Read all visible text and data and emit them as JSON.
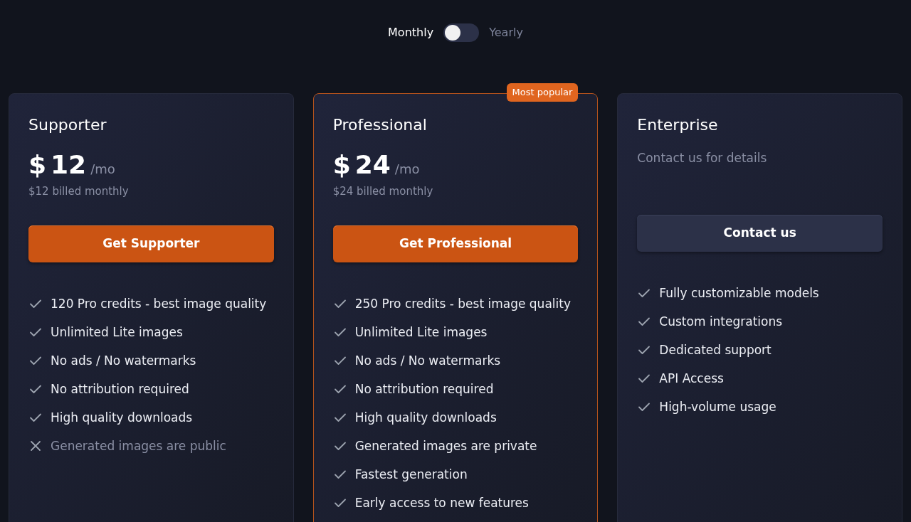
{
  "billing": {
    "options": [
      {
        "label": "Monthly",
        "selected": true
      },
      {
        "label": "Yearly",
        "selected": false
      }
    ],
    "toggle": {
      "on": false
    }
  },
  "plans": [
    {
      "name": "Supporter",
      "highlighted": false,
      "price": {
        "currency": "$",
        "amount": "12",
        "period": "/mo"
      },
      "note": "$12 billed monthly",
      "button": {
        "label": "Get Supporter",
        "kind": "primary"
      },
      "features": [
        {
          "text": "120 Pro credits - best image quality",
          "included": true
        },
        {
          "text": "Unlimited Lite images",
          "included": true
        },
        {
          "text": "No ads / No watermarks",
          "included": true
        },
        {
          "text": "No attribution required",
          "included": true
        },
        {
          "text": "High quality downloads",
          "included": true
        },
        {
          "text": "Generated images are public",
          "included": false
        }
      ]
    },
    {
      "name": "Professional",
      "highlighted": true,
      "badge": "Most popular",
      "price": {
        "currency": "$",
        "amount": "24",
        "period": "/mo"
      },
      "note": "$24 billed monthly",
      "button": {
        "label": "Get Professional",
        "kind": "primary"
      },
      "features": [
        {
          "text": "250 Pro credits - best image quality",
          "included": true
        },
        {
          "text": "Unlimited Lite images",
          "included": true
        },
        {
          "text": "No ads / No watermarks",
          "included": true
        },
        {
          "text": "No attribution required",
          "included": true
        },
        {
          "text": "High quality downloads",
          "included": true
        },
        {
          "text": "Generated images are private",
          "included": true
        },
        {
          "text": "Fastest generation",
          "included": true
        },
        {
          "text": "Early access to new features",
          "included": true
        }
      ]
    },
    {
      "name": "Enterprise",
      "highlighted": false,
      "subtitle": "Contact us for details",
      "button": {
        "label": "Contact us",
        "kind": "secondary"
      },
      "features": [
        {
          "text": "Fully customizable models",
          "included": true
        },
        {
          "text": "Custom integrations",
          "included": true
        },
        {
          "text": "Dedicated support",
          "included": true
        },
        {
          "text": "API Access",
          "included": true
        },
        {
          "text": "High-volume usage",
          "included": true
        }
      ]
    }
  ]
}
